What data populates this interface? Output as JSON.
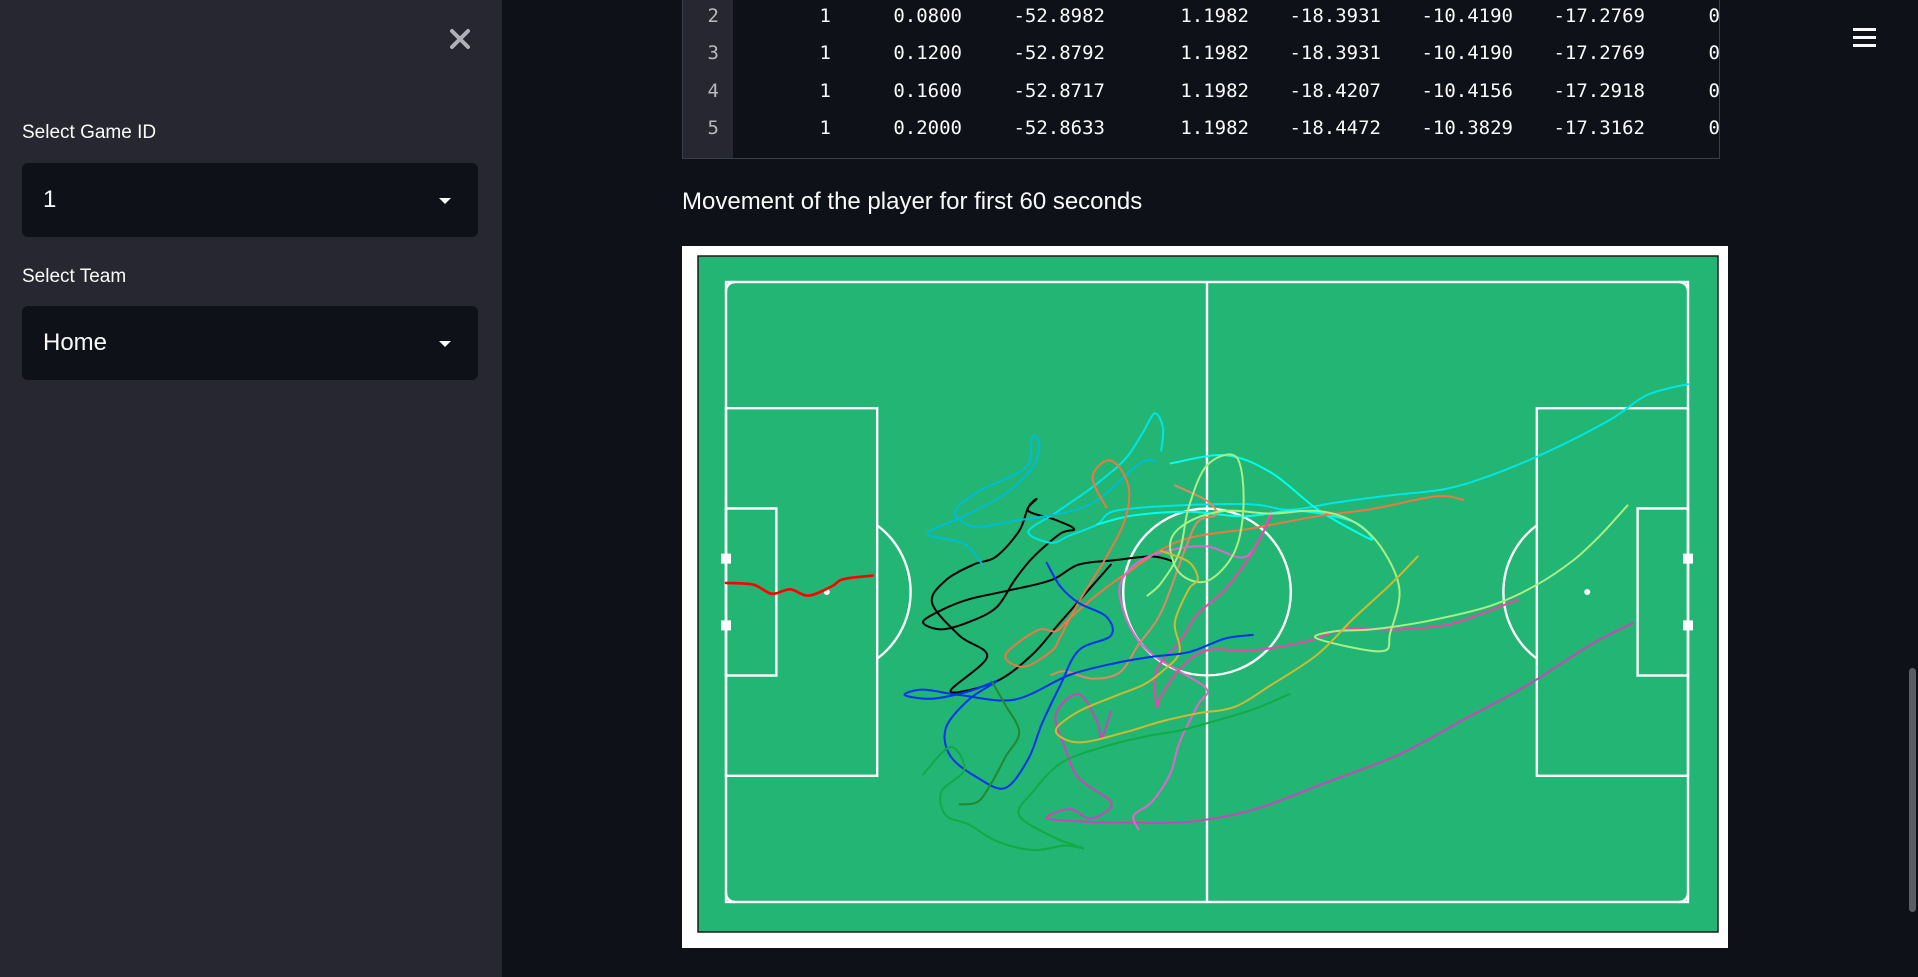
{
  "sidebar": {
    "close_icon": "close-icon",
    "game_select": {
      "label": "Select Game ID",
      "value": "1"
    },
    "team_select": {
      "label": "Select Team",
      "value": "Home"
    }
  },
  "header": {
    "menu_icon": "hamburger-menu-icon"
  },
  "table": {
    "rows": [
      {
        "index": "2",
        "c1": "1",
        "c2": "0.0800",
        "c3": "-52.8982",
        "c4": "1.1982",
        "c5": "-18.3931",
        "c6": "-10.4190",
        "c7": "-17.2769",
        "c8": "0"
      },
      {
        "index": "3",
        "c1": "1",
        "c2": "0.1200",
        "c3": "-52.8792",
        "c4": "1.1982",
        "c5": "-18.3931",
        "c6": "-10.4190",
        "c7": "-17.2769",
        "c8": "0"
      },
      {
        "index": "4",
        "c1": "1",
        "c2": "0.1600",
        "c3": "-52.8717",
        "c4": "1.1982",
        "c5": "-18.4207",
        "c6": "-10.4156",
        "c7": "-17.2918",
        "c8": "0"
      },
      {
        "index": "5",
        "c1": "1",
        "c2": "0.2000",
        "c3": "-52.8633",
        "c4": "1.1982",
        "c5": "-18.4472",
        "c6": "-10.3829",
        "c7": "-17.3162",
        "c8": "0"
      }
    ]
  },
  "main": {
    "subtitle": "Movement of the player for first 60 seconds"
  },
  "pitch": {
    "colors": {
      "grass": "#22b573",
      "lines": "#ffffff",
      "frame": "#ffffff"
    }
  },
  "chart_data": {
    "type": "line",
    "title": "",
    "xlabel": "",
    "ylabel": "",
    "xlim": [
      -52.5,
      52.5
    ],
    "ylim": [
      -34,
      34
    ],
    "grid": false,
    "series": [
      {
        "color": "#ff0000",
        "points": [
          [
            -52.5,
            1.0
          ],
          [
            -49.5,
            0.8
          ],
          [
            -47.5,
            -0.2
          ],
          [
            -45.5,
            0.3
          ],
          [
            -43.5,
            -0.4
          ],
          [
            -41.0,
            0.6
          ],
          [
            -40.0,
            1.3
          ],
          [
            -38.5,
            1.6
          ],
          [
            -36.5,
            1.8
          ]
        ]
      },
      {
        "color": "#000000",
        "points": [
          [
            -3.5,
            3.3
          ],
          [
            -6,
            3.9
          ],
          [
            -10,
            3.5
          ],
          [
            -14,
            3.0
          ],
          [
            -17,
            1.3
          ],
          [
            -21.5,
            0.2
          ],
          [
            -26,
            -0.8
          ],
          [
            -29,
            -2.0
          ],
          [
            -31,
            -3.3
          ],
          [
            -29,
            -4.1
          ],
          [
            -26,
            -3.3
          ],
          [
            -23,
            -1.7
          ],
          [
            -21,
            1.3
          ],
          [
            -19,
            3.8
          ],
          [
            -16,
            6.4
          ],
          [
            -14.5,
            6.9
          ],
          [
            -16.5,
            7.9
          ],
          [
            -19.5,
            8.9
          ],
          [
            -18.6,
            10.2
          ],
          [
            -19.5,
            9.3
          ],
          [
            -20.5,
            6.7
          ],
          [
            -23,
            3.9
          ],
          [
            -25.5,
            3.0
          ],
          [
            -28.5,
            1.3
          ],
          [
            -30,
            -1.2
          ],
          [
            -27,
            -4.8
          ],
          [
            -24,
            -7.1
          ],
          [
            -28,
            -10.9
          ],
          [
            -23,
            -9.8
          ],
          [
            -19,
            -6.8
          ],
          [
            -16,
            -3.3
          ],
          [
            -10.5,
            3.0
          ]
        ]
      },
      {
        "color": "#00e5e5",
        "points": [
          [
            52.5,
            22.8
          ],
          [
            48,
            21.6
          ],
          [
            44,
            18.9
          ],
          [
            37,
            15.3
          ],
          [
            31,
            12.8
          ],
          [
            26,
            11.3
          ],
          [
            20,
            10.6
          ],
          [
            14,
            9.8
          ],
          [
            9,
            9.0
          ],
          [
            5,
            9.6
          ],
          [
            -3,
            9.5
          ],
          [
            -10,
            8.9
          ],
          [
            -12,
            7.4
          ],
          [
            -15,
            6.2
          ],
          [
            -17,
            5.4
          ],
          [
            -19.5,
            6.6
          ],
          [
            -16.5,
            8.7
          ],
          [
            -12.5,
            11.5
          ],
          [
            -9,
            14.5
          ],
          [
            -7,
            17.5
          ],
          [
            -5.7,
            19.6
          ],
          [
            -4.8,
            18.0
          ],
          [
            -5.0,
            15.5
          ]
        ]
      },
      {
        "color": "#00bcd4",
        "points": [
          [
            -24.5,
            3.0
          ],
          [
            -26.5,
            5.3
          ],
          [
            -30.5,
            6.4
          ],
          [
            -26.5,
            8.3
          ],
          [
            -22,
            10.8
          ],
          [
            -19,
            13.7
          ],
          [
            -18.3,
            16.2
          ],
          [
            -19.1,
            17.0
          ],
          [
            -19.5,
            14.0
          ],
          [
            -22,
            12.4
          ],
          [
            -25,
            11.0
          ],
          [
            -27.5,
            8.8
          ],
          [
            -25.5,
            7.2
          ],
          [
            -21,
            7.8
          ],
          [
            -13,
            9.5
          ],
          [
            -7.5,
            14.0
          ],
          [
            -5.6,
            14.4
          ]
        ]
      },
      {
        "color": "#00ffee",
        "points": [
          [
            -4,
            14.1
          ],
          [
            2,
            15.0
          ],
          [
            7,
            13.1
          ],
          [
            12,
            9.1
          ],
          [
            17,
            6.2
          ],
          [
            18,
            5.9
          ],
          [
            16,
            7.7
          ],
          [
            10,
            8.9
          ],
          [
            4,
            8.3
          ],
          [
            -2,
            8.8
          ],
          [
            -8,
            8.4
          ],
          [
            -12,
            7.4
          ]
        ]
      },
      {
        "color": "#ee7744",
        "points": [
          [
            28,
            10.1
          ],
          [
            25,
            10.5
          ],
          [
            18,
            9.1
          ],
          [
            12,
            8.3
          ],
          [
            5,
            7.0
          ],
          [
            -3,
            5.6
          ],
          [
            -9,
            1.9
          ],
          [
            -12,
            -0.3
          ],
          [
            -15,
            -2.9
          ],
          [
            -16.5,
            -4.3
          ],
          [
            -18.5,
            -4.2
          ],
          [
            -22,
            -6.9
          ],
          [
            -20,
            -8.2
          ],
          [
            -17,
            -6.5
          ],
          [
            -16,
            -4.9
          ],
          [
            -14,
            -1.1
          ],
          [
            -11,
            3.8
          ],
          [
            -9,
            7.8
          ],
          [
            -8.5,
            11.1
          ],
          [
            -9.5,
            13.6
          ],
          [
            -11,
            14.4
          ],
          [
            -12.5,
            12.5
          ],
          [
            -11,
            9.3
          ]
        ]
      },
      {
        "color": "#dd8866",
        "points": [
          [
            -3.5,
            11.7
          ],
          [
            0,
            10.0
          ],
          [
            1,
            8.5
          ],
          [
            -1,
            7.7
          ],
          [
            -2.5,
            4.4
          ],
          [
            -5,
            -2.2
          ],
          [
            -7.5,
            -5.8
          ],
          [
            -9.5,
            -8.8
          ],
          [
            -12.5,
            -9.5
          ],
          [
            -15.5,
            -8.7
          ],
          [
            -17,
            -9.1
          ]
        ]
      },
      {
        "color": "#cc44bb",
        "points": [
          [
            46.5,
            -3.4
          ],
          [
            42,
            -5.7
          ],
          [
            35,
            -10.2
          ],
          [
            28,
            -14.0
          ],
          [
            21,
            -17.8
          ],
          [
            13,
            -20.9
          ],
          [
            5,
            -23.9
          ],
          [
            -2,
            -25.2
          ],
          [
            -8,
            -25.3
          ],
          [
            -13,
            -25.2
          ],
          [
            -17.5,
            -24.8
          ],
          [
            -15,
            -23.8
          ],
          [
            -13,
            -24.8
          ],
          [
            -11.5,
            -24.4
          ],
          [
            -10.5,
            -23.0
          ],
          [
            -14,
            -20.4
          ],
          [
            -15.5,
            -17.1
          ],
          [
            -16.5,
            -13.4
          ],
          [
            -14,
            -11.2
          ],
          [
            -12,
            -14.2
          ],
          [
            -11.5,
            -16.0
          ],
          [
            -10.5,
            -13.1
          ]
        ]
      },
      {
        "color": "#e066cc",
        "points": [
          [
            -7.5,
            -26.0
          ],
          [
            -8,
            -24.5
          ],
          [
            -6,
            -23.0
          ],
          [
            -4,
            -19.9
          ],
          [
            -3,
            -16.5
          ],
          [
            -1,
            -12.4
          ],
          [
            0,
            -10.7
          ],
          [
            -3,
            -8.7
          ],
          [
            -5.5,
            -7.2
          ],
          [
            -7.5,
            -5.3
          ],
          [
            -9,
            -2.4
          ],
          [
            -9.5,
            0.8
          ],
          [
            -7.5,
            3.3
          ],
          [
            -4,
            4.6
          ],
          [
            0,
            5.0
          ],
          [
            4,
            3.8
          ],
          [
            6,
            6.3
          ],
          [
            7,
            8.8
          ]
        ]
      },
      {
        "color": "#ee44aa",
        "points": [
          [
            34,
            -0.8
          ],
          [
            27,
            -3.4
          ],
          [
            21,
            -4.1
          ],
          [
            15,
            -4.1
          ],
          [
            11,
            -5.4
          ],
          [
            5,
            -6.4
          ],
          [
            0,
            -6.4
          ],
          [
            -3,
            -8.5
          ],
          [
            -5,
            -11.4
          ],
          [
            -5.5,
            -12.5
          ],
          [
            -5.5,
            -8.6
          ],
          [
            -3,
            -5.5
          ],
          [
            -1,
            -2.4
          ],
          [
            2,
            0.3
          ],
          [
            5,
            4.4
          ],
          [
            7,
            8.4
          ]
        ]
      },
      {
        "color": "#aaee88",
        "points": [
          [
            45.9,
            9.5
          ],
          [
            43,
            6.3
          ],
          [
            40,
            3.5
          ],
          [
            36,
            0.8
          ],
          [
            31,
            -1.5
          ],
          [
            24,
            -3.2
          ],
          [
            18,
            -4.1
          ],
          [
            14,
            -4.3
          ],
          [
            12,
            -5.1
          ],
          [
            19,
            -6.5
          ],
          [
            20,
            -4.5
          ],
          [
            21,
            0.3
          ],
          [
            19,
            4.9
          ],
          [
            16,
            7.7
          ],
          [
            12,
            8.9
          ],
          [
            7,
            8.6
          ],
          [
            2,
            8.9
          ],
          [
            -2,
            7.7
          ],
          [
            -4,
            5.5
          ],
          [
            -3,
            2.1
          ],
          [
            0,
            1.2
          ],
          [
            3,
            4.4
          ],
          [
            4,
            9.7
          ],
          [
            3.2,
            14.8
          ],
          [
            0,
            13.9
          ],
          [
            -2,
            9.3
          ],
          [
            -3,
            4.4
          ],
          [
            -5,
            1.0
          ],
          [
            -6.5,
            -0.4
          ]
        ]
      },
      {
        "color": "#ccbb33",
        "points": [
          [
            23,
            3.9
          ],
          [
            20,
            0.8
          ],
          [
            16,
            -2.9
          ],
          [
            12,
            -6.9
          ],
          [
            7,
            -10.2
          ],
          [
            3,
            -12.6
          ],
          [
            -1,
            -13.3
          ],
          [
            -5,
            -14.2
          ],
          [
            -9,
            -15.4
          ],
          [
            -14,
            -16.5
          ],
          [
            -16.5,
            -15.2
          ],
          [
            -14,
            -13.1
          ],
          [
            -10,
            -11.4
          ],
          [
            -7,
            -10.2
          ],
          [
            -5,
            -8.8
          ],
          [
            -3,
            -6.6
          ],
          [
            -3.5,
            -3.3
          ],
          [
            -2,
            0.3
          ],
          [
            -1,
            1.4
          ],
          [
            -2,
            3.3
          ],
          [
            -5,
            4.5
          ]
        ]
      },
      {
        "color": "#0033ee",
        "points": [
          [
            -17.5,
            3.2
          ],
          [
            -16,
            0.6
          ],
          [
            -14,
            -1.2
          ],
          [
            -11,
            -2.7
          ],
          [
            -10.5,
            -4.8
          ],
          [
            -14,
            -6.4
          ],
          [
            -16,
            -10.2
          ],
          [
            -18,
            -14.4
          ],
          [
            -19.5,
            -18.3
          ],
          [
            -22,
            -21.5
          ],
          [
            -25,
            -20.4
          ],
          [
            -28,
            -18.0
          ],
          [
            -28.5,
            -14.9
          ],
          [
            -26,
            -11.8
          ],
          [
            -23,
            -9.8
          ],
          [
            -26,
            -10.9
          ],
          [
            -30,
            -11.7
          ],
          [
            -33,
            -11.3
          ],
          [
            -31,
            -10.7
          ],
          [
            -27,
            -11.3
          ],
          [
            -21,
            -11.8
          ],
          [
            -15,
            -9.1
          ],
          [
            -10,
            -7.8
          ],
          [
            -6,
            -7.1
          ],
          [
            -2,
            -6.6
          ],
          [
            2,
            -5.1
          ],
          [
            5,
            -4.7
          ]
        ]
      },
      {
        "color": "#11aa44",
        "points": [
          [
            9,
            -11.2
          ],
          [
            5,
            -12.9
          ],
          [
            1,
            -14.1
          ],
          [
            -3,
            -15.2
          ],
          [
            -7,
            -15.9
          ],
          [
            -12,
            -17.2
          ],
          [
            -16,
            -18.8
          ],
          [
            -19,
            -21.9
          ],
          [
            -20.5,
            -24.5
          ],
          [
            -16.5,
            -27.0
          ],
          [
            -13.5,
            -28.1
          ],
          [
            -15.5,
            -27.8
          ],
          [
            -19,
            -28.3
          ],
          [
            -23,
            -27.3
          ],
          [
            -26,
            -25.5
          ],
          [
            -28.5,
            -24.5
          ],
          [
            -29,
            -21.9
          ],
          [
            -26.5,
            -19.5
          ],
          [
            -28,
            -17.0
          ],
          [
            -31,
            -20.0
          ]
        ]
      },
      {
        "color": "#228833",
        "points": [
          [
            -23.5,
            -9.8
          ],
          [
            -22,
            -12.4
          ],
          [
            -20.5,
            -15.4
          ],
          [
            -22,
            -18.1
          ],
          [
            -23.5,
            -20.9
          ],
          [
            -25,
            -23.0
          ],
          [
            -27,
            -23.3
          ]
        ]
      }
    ]
  }
}
